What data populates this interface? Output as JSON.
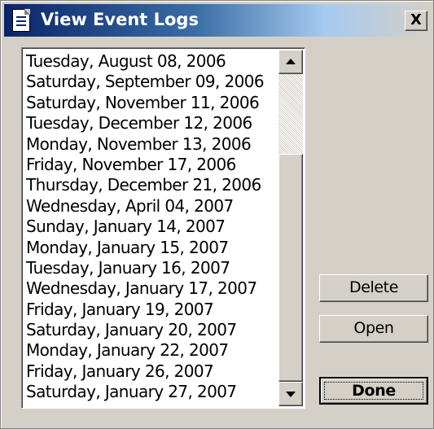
{
  "window": {
    "title": "View Event Logs",
    "close_label": "X"
  },
  "event_log_list": {
    "items": [
      "Tuesday, August 08, 2006",
      "Saturday, September 09, 2006",
      "Saturday, November 11, 2006",
      "Tuesday, December 12, 2006",
      "Monday, November 13, 2006",
      "Friday, November 17, 2006",
      "Thursday, December 21, 2006",
      "Wednesday, April 04, 2007",
      "Sunday, January 14, 2007",
      "Monday, January 15, 2007",
      "Tuesday, January 16, 2007",
      "Wednesday, January 17, 2007",
      "Friday, January 19, 2007",
      "Saturday, January 20, 2007",
      "Monday, January 22, 2007",
      "Friday, January 26, 2007",
      "Saturday, January 27, 2007"
    ]
  },
  "buttons": {
    "delete_label": "Delete",
    "open_label": "Open",
    "done_label": "Done"
  },
  "icons": {
    "title_icon": "document-icon",
    "scroll_up": "arrow-up-icon",
    "scroll_down": "arrow-down-icon"
  },
  "colors": {
    "titlebar_start": "#0a246a",
    "titlebar_end": "#d4d0c8",
    "dialog_face": "#d4d0c8"
  }
}
